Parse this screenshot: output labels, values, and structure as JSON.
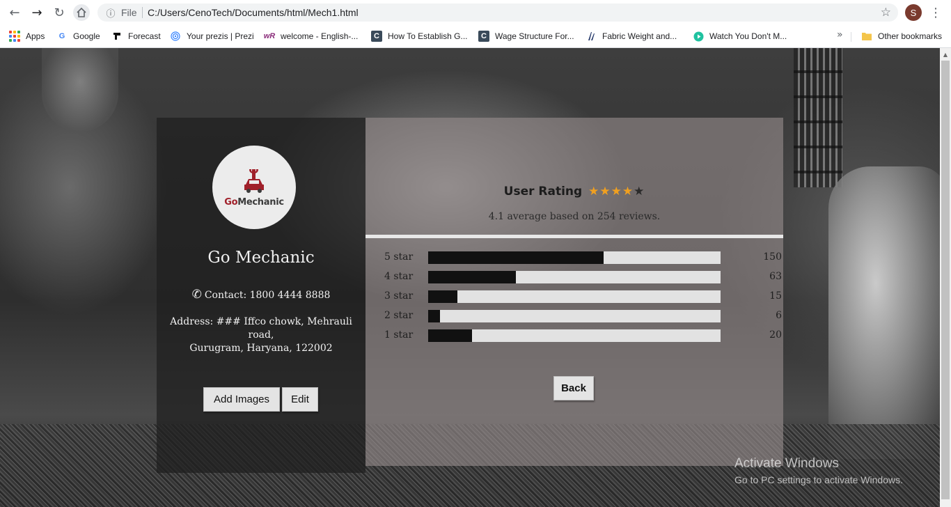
{
  "browser": {
    "address": {
      "scheme": "File",
      "url": "C:/Users/CenoTech/Documents/html/Mech1.html"
    },
    "profile_initial": "S",
    "bookmarks": [
      {
        "label": "Apps",
        "icon": "apps-grid-icon"
      },
      {
        "label": "Google",
        "icon": "google-icon"
      },
      {
        "label": "Forecast",
        "icon": "forecast-icon"
      },
      {
        "label": "Your prezis | Prezi",
        "icon": "prezi-icon"
      },
      {
        "label": "welcome - English-...",
        "icon": "wr-icon"
      },
      {
        "label": "How To Establish G...",
        "icon": "c-site-icon"
      },
      {
        "label": "Wage Structure For...",
        "icon": "c-site-icon"
      },
      {
        "label": "Fabric Weight and...",
        "icon": "fabric-icon"
      },
      {
        "label": "Watch You Don't M...",
        "icon": "play-icon"
      }
    ],
    "other_bookmarks": "Other bookmarks"
  },
  "profile": {
    "logo": {
      "go": "Go",
      "mechanic": "Mechanic"
    },
    "name": "Go Mechanic",
    "contact": "Contact: 1800 4444 8888",
    "address_line1": "Address: ### Iffco chowk, Mehrauli road,",
    "address_line2": "Gurugram, Haryana, 122002",
    "add_images_label": "Add Images",
    "edit_label": "Edit"
  },
  "rating": {
    "title": "User Rating",
    "stars_filled": 4,
    "stars_total": 5,
    "summary": "4.1 average based on 254 reviews.",
    "rows": [
      {
        "label": "5 star",
        "count": "150",
        "fill": 0.6
      },
      {
        "label": "4 star",
        "count": "63",
        "fill": 0.3
      },
      {
        "label": "3 star",
        "count": "15",
        "fill": 0.1
      },
      {
        "label": "2 star",
        "count": "6",
        "fill": 0.04
      },
      {
        "label": "1 star",
        "count": "20",
        "fill": 0.15
      }
    ],
    "back_label": "Back"
  },
  "watermark": {
    "line1": "Activate Windows",
    "line2": "Go to PC settings to activate Windows."
  },
  "colors": {
    "star_on": "#f0a020",
    "brand_red": "#a0202a"
  }
}
